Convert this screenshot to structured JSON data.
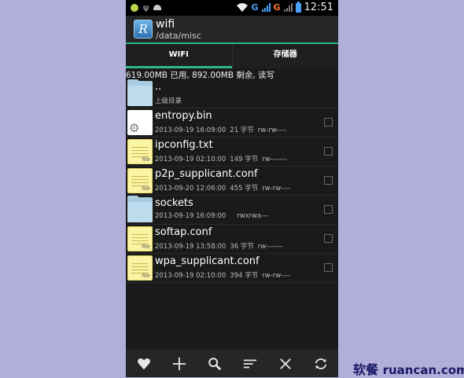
{
  "statusbar": {
    "network1": "G",
    "network2": "G",
    "time": "12:51",
    "colors": {
      "net1": "#4aa3ff",
      "net2": "#ff7733"
    }
  },
  "app": {
    "icon_letter": "R",
    "title": "wifi",
    "path": "/data/misc"
  },
  "tabs": [
    {
      "label": "WIFI",
      "active": true
    },
    {
      "label": "存储器",
      "active": false
    }
  ],
  "storage": "619.00MB 已用, 892.00MB 剩余, 读写",
  "files": [
    {
      "name": "..",
      "date": "上级目录",
      "size": "",
      "perm": "",
      "type": "folder",
      "checkbox": false
    },
    {
      "name": "entropy.bin",
      "date": "2013-09-19 16:09:00",
      "size": "21 字节",
      "perm": "rw-rw----",
      "type": "binary",
      "checkbox": true
    },
    {
      "name": "ipconfig.txt",
      "date": "2013-09-19 02:10:00",
      "size": "149 字节",
      "perm": "rw-------",
      "type": "text",
      "checkbox": true
    },
    {
      "name": "p2p_supplicant.conf",
      "date": "2013-09-20 12:06:00",
      "size": "455 字节",
      "perm": "rw-rw----",
      "type": "text",
      "checkbox": true
    },
    {
      "name": "sockets",
      "date": "2013-09-19 16:09:00",
      "size": "",
      "perm": "rwxrwx---",
      "type": "folder",
      "checkbox": true
    },
    {
      "name": "softap.conf",
      "date": "2013-09-19 13:58:00",
      "size": "36 字节",
      "perm": "rw-------",
      "type": "text",
      "checkbox": true
    },
    {
      "name": "wpa_supplicant.conf",
      "date": "2013-09-19 02:10:00",
      "size": "394 字节",
      "perm": "rw-rw----",
      "type": "text",
      "checkbox": true
    }
  ],
  "toolbar": [
    "heart-icon",
    "plus-icon",
    "search-icon",
    "sort-icon",
    "close-icon",
    "refresh-icon"
  ],
  "watermark": {
    "cn": "软餐",
    "domain": "ruancan.com"
  },
  "colors": {
    "accent": "#2eb88a",
    "background": "#b1aed9",
    "phone_bg": "#1a1a1a"
  }
}
